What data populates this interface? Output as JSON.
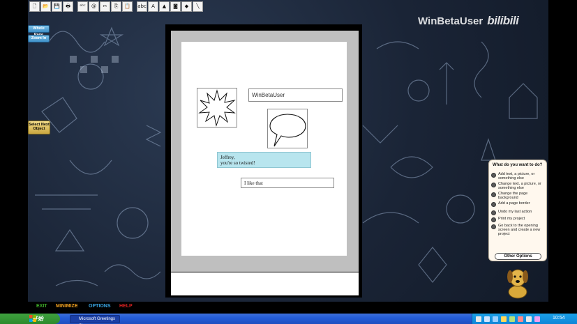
{
  "toolbar": {
    "buttons": [
      {
        "name": "new-page-icon",
        "glyph": "🗋"
      },
      {
        "name": "open-folder-icon",
        "glyph": "📂"
      },
      {
        "name": "save-icon",
        "glyph": "💾"
      },
      {
        "name": "print-icon",
        "glyph": "🖶"
      },
      {
        "name": "spell-check-icon",
        "glyph": "ᵃᵇᶜ"
      },
      {
        "name": "email-icon",
        "glyph": "@"
      },
      {
        "name": "cut-icon",
        "glyph": "✂"
      },
      {
        "name": "copy-icon",
        "glyph": "⎘"
      },
      {
        "name": "paste-icon",
        "glyph": "📋"
      },
      {
        "name": "font-icon",
        "glyph": "abc"
      },
      {
        "name": "text-icon",
        "glyph": "A"
      },
      {
        "name": "picture-icon",
        "glyph": "▲"
      },
      {
        "name": "camera-icon",
        "glyph": "◙"
      },
      {
        "name": "shapes-icon",
        "glyph": "◆"
      },
      {
        "name": "line-icon",
        "glyph": "╲"
      }
    ]
  },
  "side": {
    "whole_page": "Whole Page",
    "zoom_in": "Zoom In",
    "select_next": "Select Next Object"
  },
  "watermark": {
    "user": "WinBetaUser",
    "logo": "bilibili"
  },
  "card": {
    "title_text": "WinBetaUser",
    "message_line1": "Jeffrey,",
    "message_line2": "you're so twisted!",
    "like_text": "I like that"
  },
  "help": {
    "title": "What do you want to do?",
    "items": [
      "Add text, a picture, or something else",
      "Change text, a picture, or something else",
      "Change the page background",
      "Add a page border",
      "Undo my last action",
      "Print my project",
      "Go back to the opening screen and create a new project"
    ],
    "other_options": "Other Options"
  },
  "bottom": {
    "exit": "EXIT",
    "minimize": "MINIMIZE",
    "options": "OPTIONS",
    "help": "HELP",
    "colors": {
      "exit": "#3fae2a",
      "minimize": "#f0a020",
      "options": "#3aa8e8",
      "help": "#d42020"
    }
  },
  "taskbar": {
    "start_label": "开始",
    "task_item": "Microsoft Greetings ...",
    "clock": "10:54"
  }
}
